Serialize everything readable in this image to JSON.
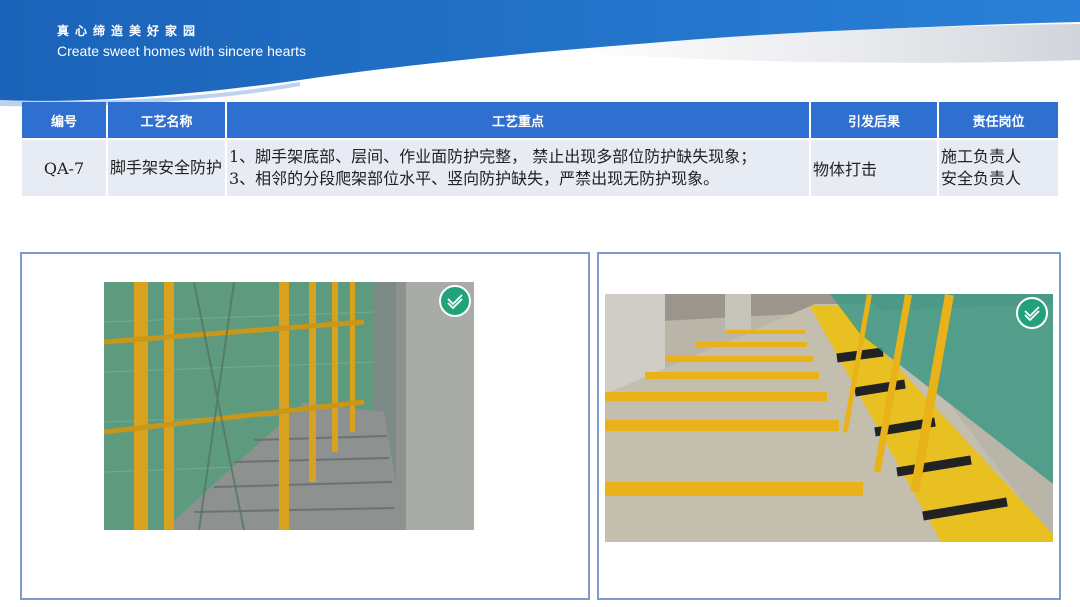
{
  "header": {
    "slogan_cn": "真心缔造美好家园",
    "slogan_en": "Create sweet homes with sincere hearts",
    "colors": {
      "band": "#1e6fc6",
      "band_light": "#3a8be0"
    }
  },
  "table": {
    "headers": {
      "code": "编号",
      "name": "工艺名称",
      "points": "工艺重点",
      "result": "引发后果",
      "responsible": "责任岗位"
    },
    "row": {
      "code": "QA-7",
      "name": "脚手架安全防护",
      "points": [
        "1、脚手架底部、层间、作业面防护完整， 禁止出现多部位防护缺失现象；",
        "3、相邻的分段爬架部位水平、竖向防护缺失，严禁出现无防护现象。"
      ],
      "result": "物体打击",
      "responsible": [
        "施工负责人",
        "安全负责人"
      ]
    },
    "colors": {
      "header_bg": "#2f6fcf",
      "cell_bg": "#e7ebf3"
    }
  },
  "photos": {
    "left": {
      "icon": "check-badge-icon",
      "subject": "scaffold-walkway-with-green-safety-net"
    },
    "right": {
      "icon": "check-badge-icon",
      "subject": "climbing-frame-edge-protection-with-yellow-barriers"
    }
  },
  "colors": {
    "panel_border": "#7e9bd0",
    "check_badge": "#22a27a"
  }
}
